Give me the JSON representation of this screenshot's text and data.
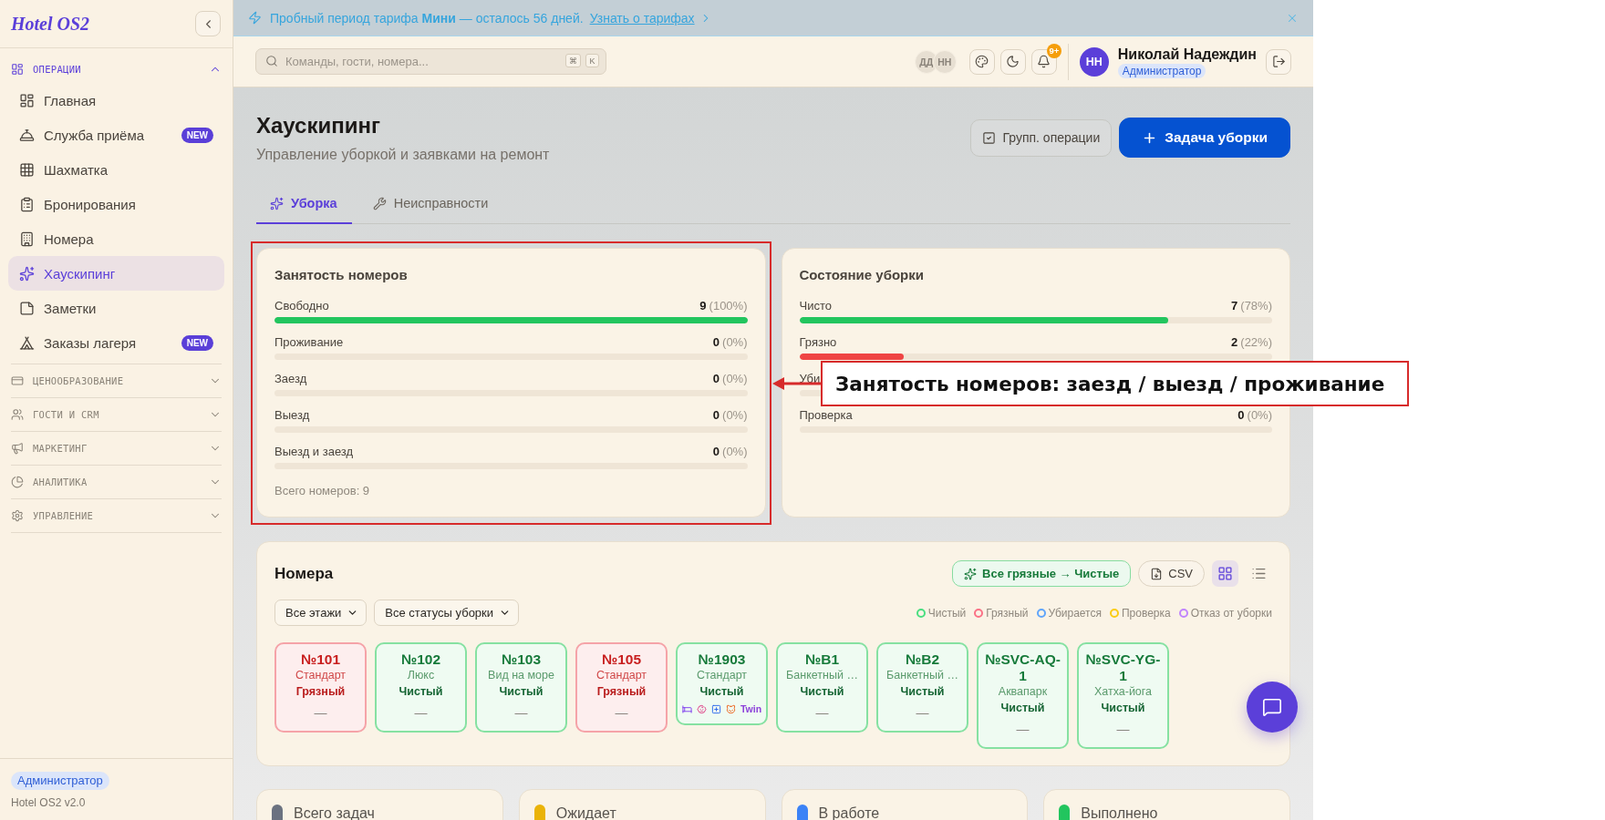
{
  "banner": {
    "message": "Пробный период тарифа **Мини** — осталось 56 дней.",
    "link": "Узнать о тарифах"
  },
  "sidebar": {
    "logo": "Hotel OS2",
    "sections": [
      {
        "title": "ОПЕРАЦИИ",
        "expanded": true,
        "items": [
          {
            "label": "Главная",
            "selected": false
          },
          {
            "label": "Служба приёма",
            "selected": false,
            "badge": "NEW"
          },
          {
            "label": "Шахматка",
            "selected": false
          },
          {
            "label": "Бронирования",
            "selected": false
          },
          {
            "label": "Номера",
            "selected": false
          },
          {
            "label": "Хаускипинг",
            "selected": true
          },
          {
            "label": "Заметки",
            "selected": false
          },
          {
            "label": "Заказы лагеря",
            "selected": false,
            "badge": "NEW"
          }
        ]
      },
      {
        "title": "ЦЕНООБРАЗОВАНИЕ",
        "expanded": false
      },
      {
        "title": "ГОСТИ И CRM",
        "expanded": false
      },
      {
        "title": "МАРКЕТИНГ",
        "expanded": false
      },
      {
        "title": "АНАЛИТИКА",
        "expanded": false
      },
      {
        "title": "УПРАВЛЕНИЕ",
        "expanded": false
      }
    ],
    "footer": {
      "role": "Администратор",
      "version": "Hotel OS2 v2.0"
    }
  },
  "topbar": {
    "search": {
      "placeholder": "Команды, гости, номера...",
      "keys": [
        "⌘",
        "K"
      ]
    },
    "presence": [
      "ДД",
      "НН"
    ],
    "notifications": "9+",
    "user": {
      "initials": "НН",
      "name": "Николай Надеждин",
      "role": "Администратор"
    }
  },
  "page": {
    "title": "Хаускипинг",
    "subtitle": "Управление уборкой и заявками на ремонт",
    "actions": [
      {
        "label": "Групп. операции",
        "kind": "secondary"
      },
      {
        "label": "Задача уборки",
        "kind": "primary"
      }
    ]
  },
  "tabs": [
    {
      "label": "Уборка",
      "selected": true
    },
    {
      "label": "Неисправности",
      "selected": false
    }
  ],
  "occupancy": {
    "title": "Занятость номеров",
    "rows": [
      {
        "label": "Свободно",
        "count": "9",
        "percent": "(100%)",
        "level": 1,
        "color": "#22c55e"
      },
      {
        "label": "Проживание",
        "count": "0",
        "percent": "(0%)"
      },
      {
        "label": "Заезд",
        "count": "0",
        "percent": "(0%)"
      },
      {
        "label": "Выезд",
        "count": "0",
        "percent": "(0%)"
      },
      {
        "label": "Выезд и заезд",
        "count": "0",
        "percent": "(0%)"
      }
    ],
    "total": "Всего номеров: 9"
  },
  "cleaning": {
    "title": "Состояние уборки",
    "rows": [
      {
        "label": "Чисто",
        "count": "7",
        "percent": "(78%)",
        "level": 0.78,
        "color": "#22c55e"
      },
      {
        "label": "Грязно",
        "count": "2",
        "percent": "(22%)",
        "level": 0.22,
        "color": "#ef4444"
      },
      {
        "label": "Уби"
      },
      {
        "label": "Проверка",
        "count": "0",
        "percent": "(0%)"
      }
    ]
  },
  "rooms": {
    "title": "Номера",
    "bulk_action": "Все грязные → Чистые",
    "export": "CSV",
    "views": [
      {
        "kind": "grid",
        "selected": true
      },
      {
        "kind": "list",
        "selected": false
      }
    ],
    "filters": [
      "Все этажи",
      "Все статусы уборки"
    ],
    "legend": [
      {
        "label": "Чистый",
        "color": "#4ade80"
      },
      {
        "label": "Грязный",
        "color": "#fb7185"
      },
      {
        "label": "Убирается",
        "color": "#60a5fa"
      },
      {
        "label": "Проверка",
        "color": "#facc15"
      },
      {
        "label": "Отказ от уборки",
        "color": "#c084fc"
      }
    ],
    "tiles": [
      {
        "number": "№101",
        "type": "Стандарт",
        "status": "Грязный",
        "kind": "dirty",
        "note": "—"
      },
      {
        "number": "№102",
        "type": "Люкс",
        "status": "Чистый",
        "kind": "clean",
        "note": "—"
      },
      {
        "number": "№103",
        "type": "Вид на море",
        "status": "Чистый",
        "kind": "clean",
        "note": "—"
      },
      {
        "number": "№105",
        "type": "Стандарт",
        "status": "Грязный",
        "kind": "dirty",
        "note": "—"
      },
      {
        "number": "№1903",
        "type": "Стандарт",
        "status": "Чистый",
        "kind": "clean",
        "markers": [
          {
            "kind": "bed"
          },
          {
            "kind": "baby"
          },
          {
            "kind": "medical"
          },
          {
            "kind": "pet"
          }
        ],
        "bed_type": "Twin"
      },
      {
        "number": "№B1",
        "type": "Банкетный …",
        "status": "Чистый",
        "kind": "clean",
        "note": "—"
      },
      {
        "number": "№B2",
        "type": "Банкетный …",
        "status": "Чистый",
        "kind": "clean",
        "note": "—"
      },
      {
        "number": "№SVC-AQ-1",
        "type": "Аквапарк",
        "status": "Чистый",
        "kind": "clean",
        "note": "—"
      },
      {
        "number": "№SVC-YG-1",
        "type": "Хатха-йога",
        "status": "Чистый",
        "kind": "clean",
        "note": "—"
      }
    ]
  },
  "summary": [
    {
      "label": "Всего задач",
      "color": "#6b7280"
    },
    {
      "label": "Ожидает",
      "color": "#eab308"
    },
    {
      "label": "В работе",
      "color": "#3b82f6"
    },
    {
      "label": "Выполнено",
      "color": "#22c55e"
    }
  ],
  "annotation": {
    "label": "Занятость номеров: заезд / выезд / проживание"
  }
}
